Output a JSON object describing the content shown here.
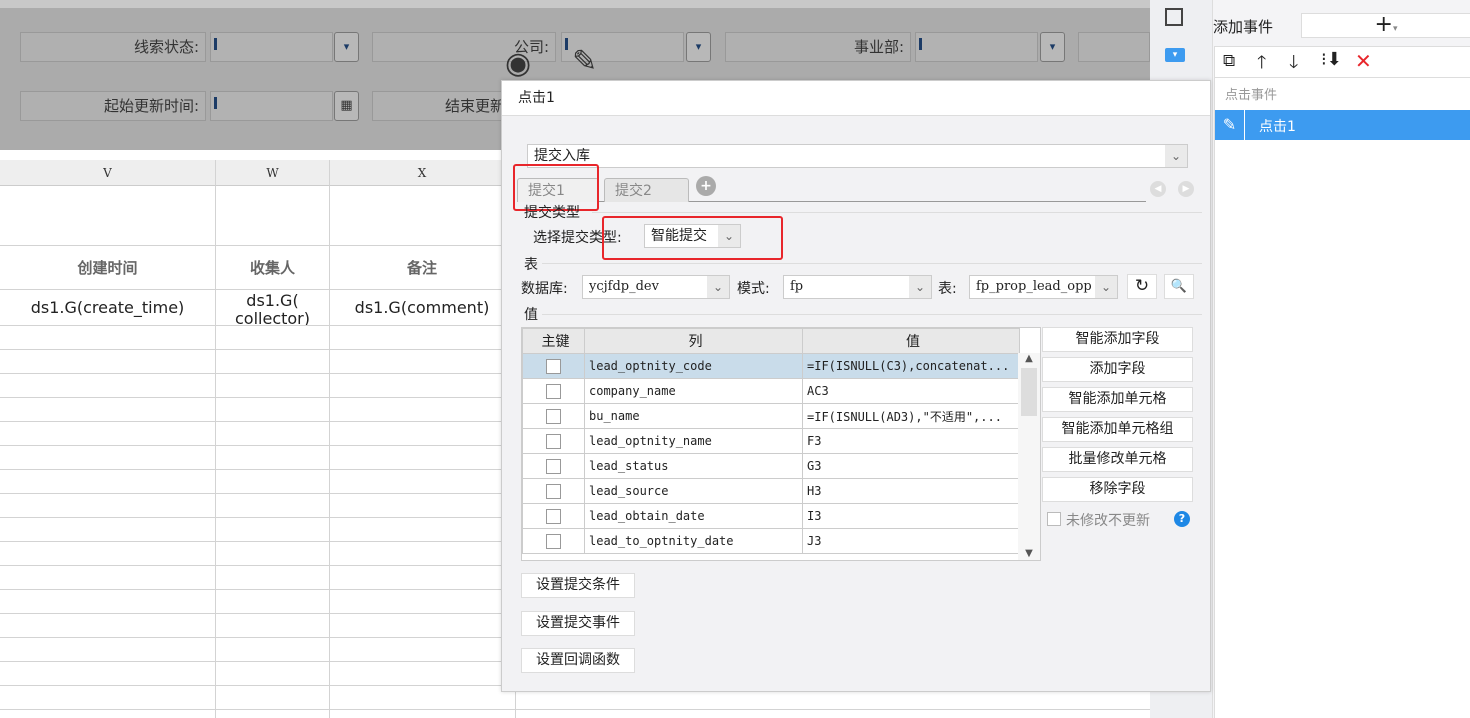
{
  "filters": {
    "row1": [
      {
        "label": "线索状态:"
      },
      {
        "label": "公司:"
      },
      {
        "label": "事业部:"
      }
    ],
    "row2": [
      {
        "label": "起始更新时间:"
      },
      {
        "label": "结束更新"
      }
    ]
  },
  "grid": {
    "columns": [
      "V",
      "W",
      "X"
    ],
    "headers": [
      "创建时间",
      "收集人",
      "备注"
    ],
    "data": [
      "ds1.G(create_time)",
      "ds1.G(\ncollector)",
      "ds1.G(comment)"
    ]
  },
  "dialog": {
    "title": "点击1",
    "action": "提交入库",
    "tabs": [
      "提交1",
      "提交2"
    ],
    "submit_type_section": "提交类型",
    "submit_type_label": "选择提交类型:",
    "submit_type_value": "智能提交",
    "table_section": "表",
    "db_label": "数据库:",
    "db_value": "ycjfdp_dev",
    "schema_label": "模式:",
    "schema_value": "fp",
    "table_label": "表:",
    "table_value": "fp_prop_lead_opp",
    "value_section": "值",
    "value_table": {
      "headers": [
        "主键",
        "列",
        "值"
      ],
      "rows": [
        {
          "col": "lead_optnity_code",
          "val": "=IF(ISNULL(C3),concatenat..."
        },
        {
          "col": "company_name",
          "val": "AC3"
        },
        {
          "col": "bu_name",
          "val": "=IF(ISNULL(AD3),\"不适用\",..."
        },
        {
          "col": "lead_optnity_name",
          "val": "F3"
        },
        {
          "col": "lead_status",
          "val": "G3"
        },
        {
          "col": "lead_source",
          "val": "H3"
        },
        {
          "col": "lead_obtain_date",
          "val": "I3"
        },
        {
          "col": "lead_to_optnity_date",
          "val": "J3"
        }
      ]
    },
    "side_buttons": [
      "智能添加字段",
      "添加字段",
      "智能添加单元格",
      "智能添加单元格组",
      "批量修改单元格",
      "移除字段"
    ],
    "no_update_label": "未修改不更新",
    "bottom_buttons": [
      "设置提交条件",
      "设置提交事件",
      "设置回调函数"
    ]
  },
  "panel": {
    "add_event_label": "添加事件",
    "event_group": "点击事件",
    "event_item": "点击1"
  },
  "colors": {
    "accent": "#3d9bf0",
    "red": "#e8262b"
  }
}
